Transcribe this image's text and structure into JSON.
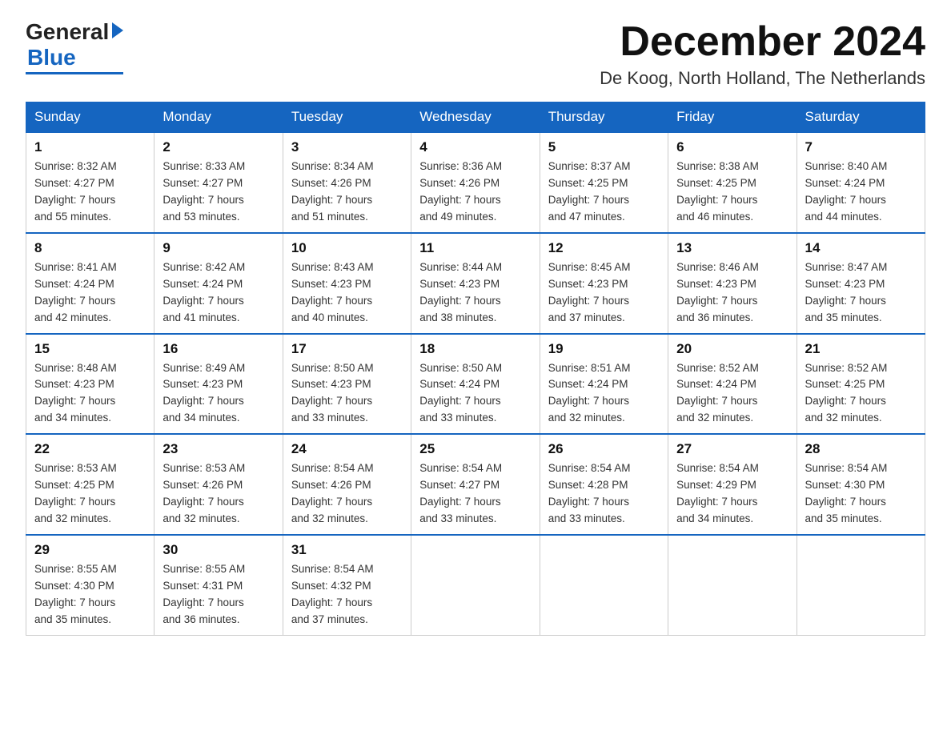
{
  "logo": {
    "general": "General",
    "blue": "Blue"
  },
  "title": "December 2024",
  "location": "De Koog, North Holland, The Netherlands",
  "headers": [
    "Sunday",
    "Monday",
    "Tuesday",
    "Wednesday",
    "Thursday",
    "Friday",
    "Saturday"
  ],
  "weeks": [
    [
      {
        "day": "1",
        "info": "Sunrise: 8:32 AM\nSunset: 4:27 PM\nDaylight: 7 hours\nand 55 minutes."
      },
      {
        "day": "2",
        "info": "Sunrise: 8:33 AM\nSunset: 4:27 PM\nDaylight: 7 hours\nand 53 minutes."
      },
      {
        "day": "3",
        "info": "Sunrise: 8:34 AM\nSunset: 4:26 PM\nDaylight: 7 hours\nand 51 minutes."
      },
      {
        "day": "4",
        "info": "Sunrise: 8:36 AM\nSunset: 4:26 PM\nDaylight: 7 hours\nand 49 minutes."
      },
      {
        "day": "5",
        "info": "Sunrise: 8:37 AM\nSunset: 4:25 PM\nDaylight: 7 hours\nand 47 minutes."
      },
      {
        "day": "6",
        "info": "Sunrise: 8:38 AM\nSunset: 4:25 PM\nDaylight: 7 hours\nand 46 minutes."
      },
      {
        "day": "7",
        "info": "Sunrise: 8:40 AM\nSunset: 4:24 PM\nDaylight: 7 hours\nand 44 minutes."
      }
    ],
    [
      {
        "day": "8",
        "info": "Sunrise: 8:41 AM\nSunset: 4:24 PM\nDaylight: 7 hours\nand 42 minutes."
      },
      {
        "day": "9",
        "info": "Sunrise: 8:42 AM\nSunset: 4:24 PM\nDaylight: 7 hours\nand 41 minutes."
      },
      {
        "day": "10",
        "info": "Sunrise: 8:43 AM\nSunset: 4:23 PM\nDaylight: 7 hours\nand 40 minutes."
      },
      {
        "day": "11",
        "info": "Sunrise: 8:44 AM\nSunset: 4:23 PM\nDaylight: 7 hours\nand 38 minutes."
      },
      {
        "day": "12",
        "info": "Sunrise: 8:45 AM\nSunset: 4:23 PM\nDaylight: 7 hours\nand 37 minutes."
      },
      {
        "day": "13",
        "info": "Sunrise: 8:46 AM\nSunset: 4:23 PM\nDaylight: 7 hours\nand 36 minutes."
      },
      {
        "day": "14",
        "info": "Sunrise: 8:47 AM\nSunset: 4:23 PM\nDaylight: 7 hours\nand 35 minutes."
      }
    ],
    [
      {
        "day": "15",
        "info": "Sunrise: 8:48 AM\nSunset: 4:23 PM\nDaylight: 7 hours\nand 34 minutes."
      },
      {
        "day": "16",
        "info": "Sunrise: 8:49 AM\nSunset: 4:23 PM\nDaylight: 7 hours\nand 34 minutes."
      },
      {
        "day": "17",
        "info": "Sunrise: 8:50 AM\nSunset: 4:23 PM\nDaylight: 7 hours\nand 33 minutes."
      },
      {
        "day": "18",
        "info": "Sunrise: 8:50 AM\nSunset: 4:24 PM\nDaylight: 7 hours\nand 33 minutes."
      },
      {
        "day": "19",
        "info": "Sunrise: 8:51 AM\nSunset: 4:24 PM\nDaylight: 7 hours\nand 32 minutes."
      },
      {
        "day": "20",
        "info": "Sunrise: 8:52 AM\nSunset: 4:24 PM\nDaylight: 7 hours\nand 32 minutes."
      },
      {
        "day": "21",
        "info": "Sunrise: 8:52 AM\nSunset: 4:25 PM\nDaylight: 7 hours\nand 32 minutes."
      }
    ],
    [
      {
        "day": "22",
        "info": "Sunrise: 8:53 AM\nSunset: 4:25 PM\nDaylight: 7 hours\nand 32 minutes."
      },
      {
        "day": "23",
        "info": "Sunrise: 8:53 AM\nSunset: 4:26 PM\nDaylight: 7 hours\nand 32 minutes."
      },
      {
        "day": "24",
        "info": "Sunrise: 8:54 AM\nSunset: 4:26 PM\nDaylight: 7 hours\nand 32 minutes."
      },
      {
        "day": "25",
        "info": "Sunrise: 8:54 AM\nSunset: 4:27 PM\nDaylight: 7 hours\nand 33 minutes."
      },
      {
        "day": "26",
        "info": "Sunrise: 8:54 AM\nSunset: 4:28 PM\nDaylight: 7 hours\nand 33 minutes."
      },
      {
        "day": "27",
        "info": "Sunrise: 8:54 AM\nSunset: 4:29 PM\nDaylight: 7 hours\nand 34 minutes."
      },
      {
        "day": "28",
        "info": "Sunrise: 8:54 AM\nSunset: 4:30 PM\nDaylight: 7 hours\nand 35 minutes."
      }
    ],
    [
      {
        "day": "29",
        "info": "Sunrise: 8:55 AM\nSunset: 4:30 PM\nDaylight: 7 hours\nand 35 minutes."
      },
      {
        "day": "30",
        "info": "Sunrise: 8:55 AM\nSunset: 4:31 PM\nDaylight: 7 hours\nand 36 minutes."
      },
      {
        "day": "31",
        "info": "Sunrise: 8:54 AM\nSunset: 4:32 PM\nDaylight: 7 hours\nand 37 minutes."
      },
      {
        "day": "",
        "info": ""
      },
      {
        "day": "",
        "info": ""
      },
      {
        "day": "",
        "info": ""
      },
      {
        "day": "",
        "info": ""
      }
    ]
  ]
}
